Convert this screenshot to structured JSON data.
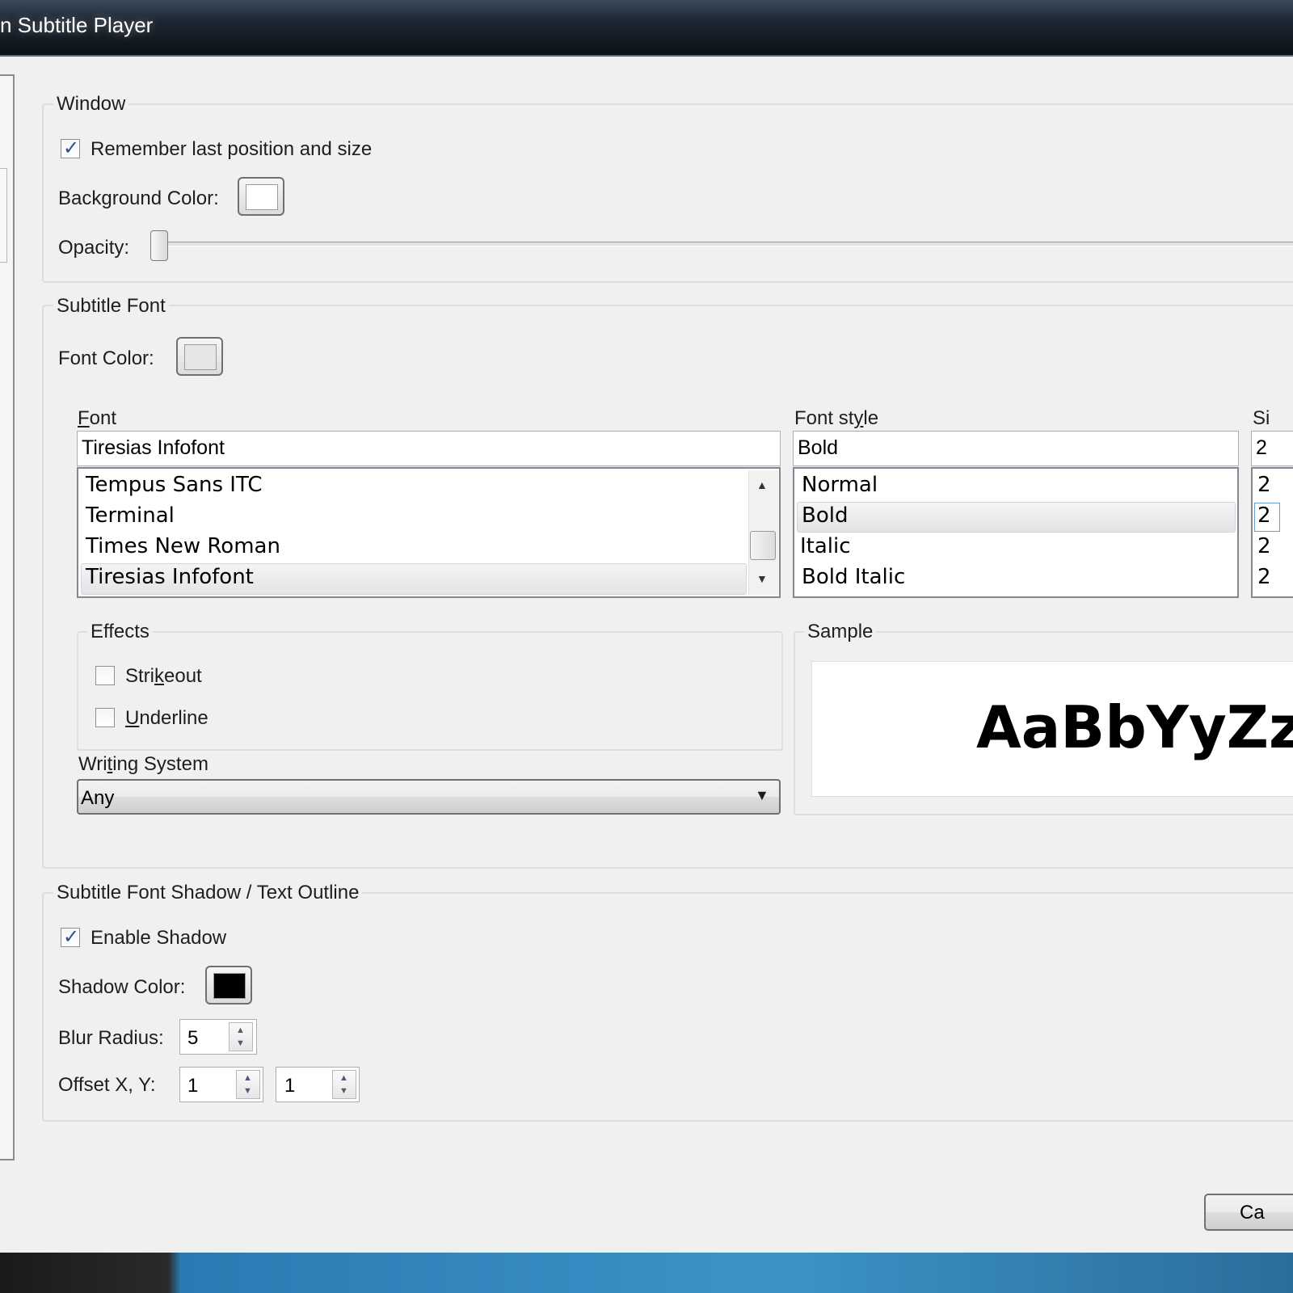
{
  "window": {
    "title": "n Subtitle Player"
  },
  "window_group": {
    "title": "Window",
    "remember_label": "Remember last position and size",
    "remember_checked": true,
    "background_color_label": "Background Color:",
    "background_color": "#ffffff",
    "opacity_label": "Opacity:",
    "opacity_value": 0
  },
  "font_group": {
    "title": "Subtitle Font",
    "font_color_label": "Font Color:",
    "font_color": "#e6e6e6",
    "font_label": "Font",
    "font_value": "Tiresias Infofont",
    "font_list": [
      "Tempus Sans ITC",
      "Terminal",
      "Times New Roman",
      "Tiresias Infofont"
    ],
    "font_selected": "Tiresias Infofont",
    "style_label": "Font style",
    "style_value": "Bold",
    "style_list": [
      "Normal",
      "Bold",
      "Italic",
      "Bold Italic"
    ],
    "style_selected": "Bold",
    "size_label": "Si",
    "size_value": "2",
    "size_list": [
      "2",
      "2",
      "2",
      "2"
    ],
    "effects_title": "Effects",
    "strikeout_label": "Strikeout",
    "strikeout_checked": false,
    "underline_label": "Underline",
    "underline_checked": false,
    "writing_system_label": "Writing System",
    "writing_system_value": "Any",
    "sample_title": "Sample",
    "sample_text": "AaBbYyZz"
  },
  "shadow_group": {
    "title": "Subtitle Font Shadow / Text Outline",
    "enable_label": "Enable Shadow",
    "enable_checked": true,
    "shadow_color_label": "Shadow Color:",
    "shadow_color": "#000000",
    "blur_label": "Blur Radius:",
    "blur_value": "5",
    "offset_label": "Offset X, Y:",
    "offset_x": "1",
    "offset_y": "1"
  },
  "buttons": {
    "cancel_label": "Ca"
  },
  "colors": {
    "title_bar": "#1c2530",
    "taskbar_accent": "#3d93c8",
    "selection": "#e3e4e6"
  }
}
